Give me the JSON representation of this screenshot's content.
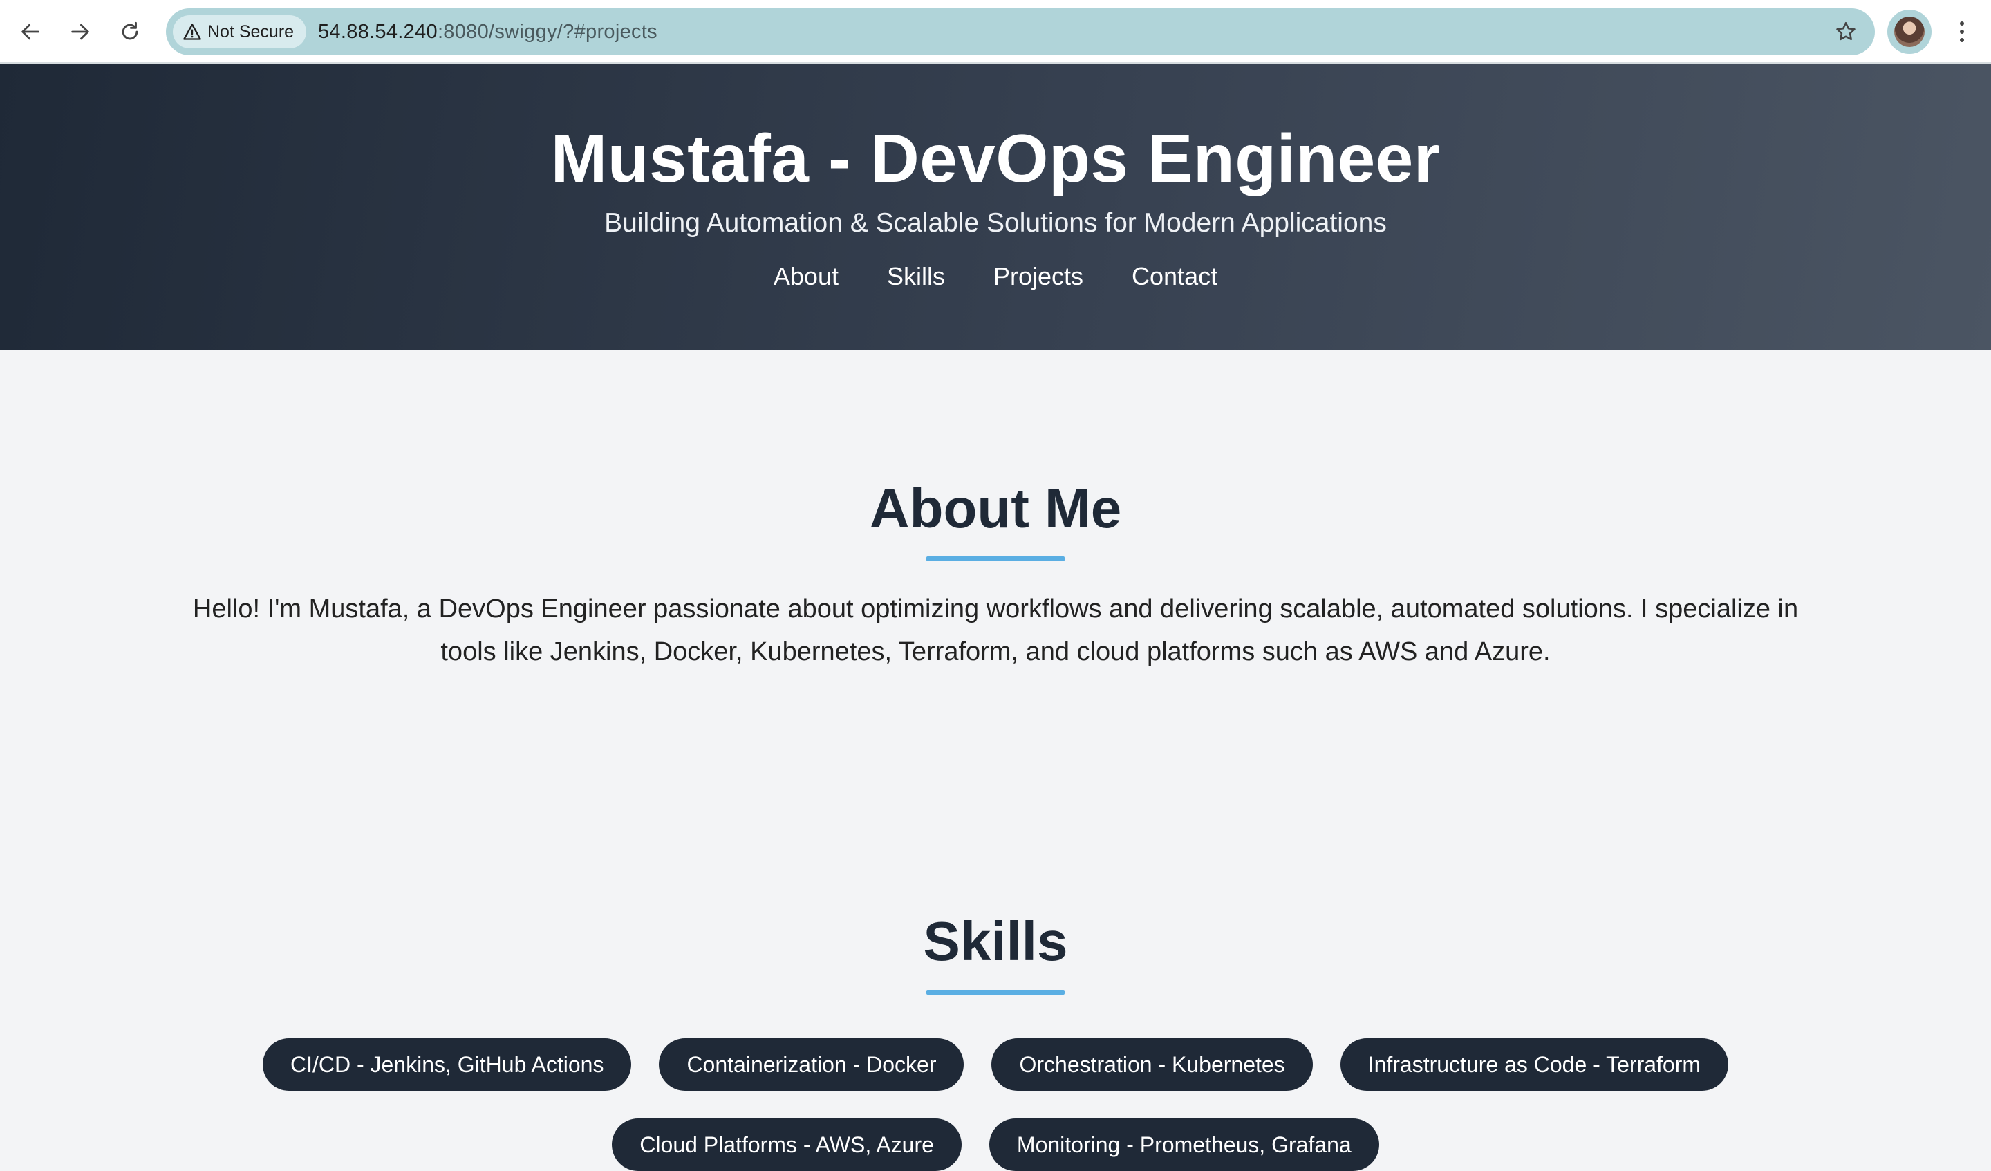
{
  "browser": {
    "security_label": "Not Secure",
    "url_host": "54.88.54.240",
    "url_rest": ":8080/swiggy/?#projects",
    "icons": {
      "back": "arrow-left-icon",
      "forward": "arrow-right-icon",
      "reload": "reload-icon",
      "security": "warning-triangle-icon",
      "bookmark": "star-icon",
      "menu": "vertical-dots-icon"
    }
  },
  "header": {
    "title": "Mustafa - DevOps Engineer",
    "subtitle": "Building Automation & Scalable Solutions for Modern Applications",
    "nav": [
      {
        "label": "About"
      },
      {
        "label": "Skills"
      },
      {
        "label": "Projects"
      },
      {
        "label": "Contact"
      }
    ]
  },
  "about": {
    "heading": "About Me",
    "text": "Hello! I'm Mustafa, a DevOps Engineer passionate about optimizing workflows and delivering scalable, automated solutions. I specialize in tools like Jenkins, Docker, Kubernetes, Terraform, and cloud platforms such as AWS and Azure."
  },
  "skills": {
    "heading": "Skills",
    "items": [
      {
        "label": "CI/CD - Jenkins, GitHub Actions"
      },
      {
        "label": "Containerization - Docker"
      },
      {
        "label": "Orchestration - Kubernetes"
      },
      {
        "label": "Infrastructure as Code - Terraform"
      },
      {
        "label": "Cloud Platforms - AWS, Azure"
      },
      {
        "label": "Monitoring - Prometheus, Grafana"
      }
    ]
  },
  "colors": {
    "header_gradient_start": "#1f2937",
    "header_gradient_end": "#4b5563",
    "accent_underline": "#5aaee3",
    "pill_background": "#1f2937",
    "page_background": "#f3f4f6"
  }
}
